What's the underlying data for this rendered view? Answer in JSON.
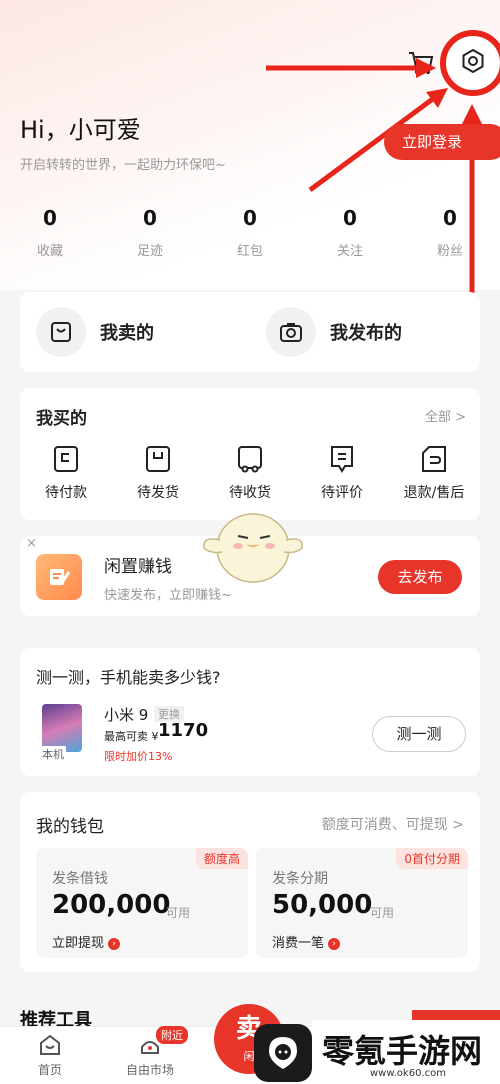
{
  "header": {
    "greeting": "Hi，小可爱",
    "subtitle": "开启转转的世界，一起助力环保吧~",
    "login_button": "立即登录",
    "icons": [
      "cart-icon",
      "gear-icon"
    ],
    "accent_color": "#e8352a"
  },
  "stats": [
    {
      "value": "0",
      "label": "收藏"
    },
    {
      "value": "0",
      "label": "足迹"
    },
    {
      "value": "0",
      "label": "红包"
    },
    {
      "value": "0",
      "label": "关注"
    },
    {
      "value": "0",
      "label": "粉丝"
    }
  ],
  "sell_card": {
    "my_sold": "我卖的",
    "my_published": "我发布的"
  },
  "buy_card": {
    "title": "我买的",
    "all_link": "全部 >",
    "items": [
      {
        "label": "待付款",
        "icon": "wallet-icon"
      },
      {
        "label": "待发货",
        "icon": "box-icon"
      },
      {
        "label": "待收货",
        "icon": "truck-icon"
      },
      {
        "label": "待评价",
        "icon": "comment-icon"
      },
      {
        "label": "退款/售后",
        "icon": "refund-icon"
      }
    ]
  },
  "idle_card": {
    "close": "×",
    "title": "闲置赚钱",
    "subtitle": "快速发布，立即赚钱~",
    "button": "去发布"
  },
  "test_card": {
    "title": "测一测，手机能卖多少钱?",
    "phone_tag": "本机",
    "model": "小米 9",
    "swap": "更换",
    "max_sell": "最高可卖 ¥",
    "price": "1170",
    "limit_note": "限时加价13%",
    "button": "测一测"
  },
  "wallet": {
    "title": "我的钱包",
    "subtitle": "额度可消费、可提现 >",
    "boxes": [
      {
        "badge": "额度高",
        "title": "发条借钱",
        "amount": "200,000",
        "unit": "可用",
        "action": "立即提现"
      },
      {
        "badge": "0首付分期",
        "title": "发条分期",
        "amount": "50,000",
        "unit": "可用",
        "action": "消费一笔"
      }
    ]
  },
  "recommend_title": "推荐工具",
  "tabbar": {
    "home": "首页",
    "market": "自由市场",
    "near_badge": "附近",
    "sell_big": "卖",
    "sell_small": "闲"
  },
  "watermark": {
    "text": "零氪手游网",
    "url": "www.ok60.com"
  }
}
